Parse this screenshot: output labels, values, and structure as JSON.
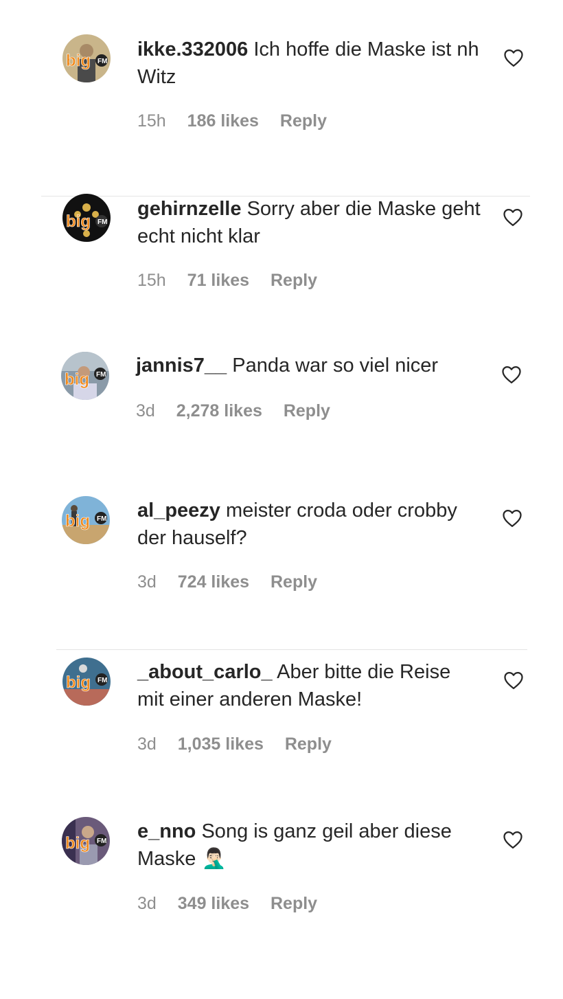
{
  "comments": [
    {
      "username": "ikke.332006",
      "text": "Ich hoffe die Maske ist nh Witz",
      "time": "15h",
      "likes": "186 likes",
      "reply": "Reply",
      "avatar_label": "big",
      "avatar_badge": "FM",
      "avatar_bg": "#c9b58a"
    },
    {
      "username": "gehirnzelle",
      "text": "Sorry aber die Maske geht echt nicht klar",
      "time": "15h",
      "likes": "71 likes",
      "reply": "Reply",
      "avatar_label": "big",
      "avatar_badge": "FM",
      "avatar_bg": "#111111"
    },
    {
      "username": "jannis7__",
      "text": "Panda war so viel nicer",
      "time": "3d",
      "likes": "2,278 likes",
      "reply": "Reply",
      "avatar_label": "big",
      "avatar_badge": "FM",
      "avatar_bg": "#8a9aa8"
    },
    {
      "username": "al_peezy",
      "text": "meister croda oder crobby der hauself?",
      "time": "3d",
      "likes": "724 likes",
      "reply": "Reply",
      "avatar_label": "big",
      "avatar_badge": "FM",
      "avatar_bg": "#7fb3d8"
    },
    {
      "username": "_about_carlo_",
      "text": "Aber bitte die Reise mit einer anderen Maske!",
      "time": "3d",
      "likes": "1,035 likes",
      "reply": "Reply",
      "avatar_label": "big",
      "avatar_badge": "FM",
      "avatar_bg": "#3f6f8f"
    },
    {
      "username": "e_nno",
      "text": "Song is ganz geil aber diese Maske 🤦🏻‍♂️",
      "time": "3d",
      "likes": "349 likes",
      "reply": "Reply",
      "avatar_label": "big",
      "avatar_badge": "FM",
      "avatar_bg": "#6a5a7a"
    }
  ],
  "icons": {
    "like": "heart-outline-icon",
    "avatar_logo": "bigfm-logo"
  },
  "colors": {
    "text": "#262626",
    "secondary": "#8e8e8e",
    "logo_orange": "#f18a1c"
  }
}
